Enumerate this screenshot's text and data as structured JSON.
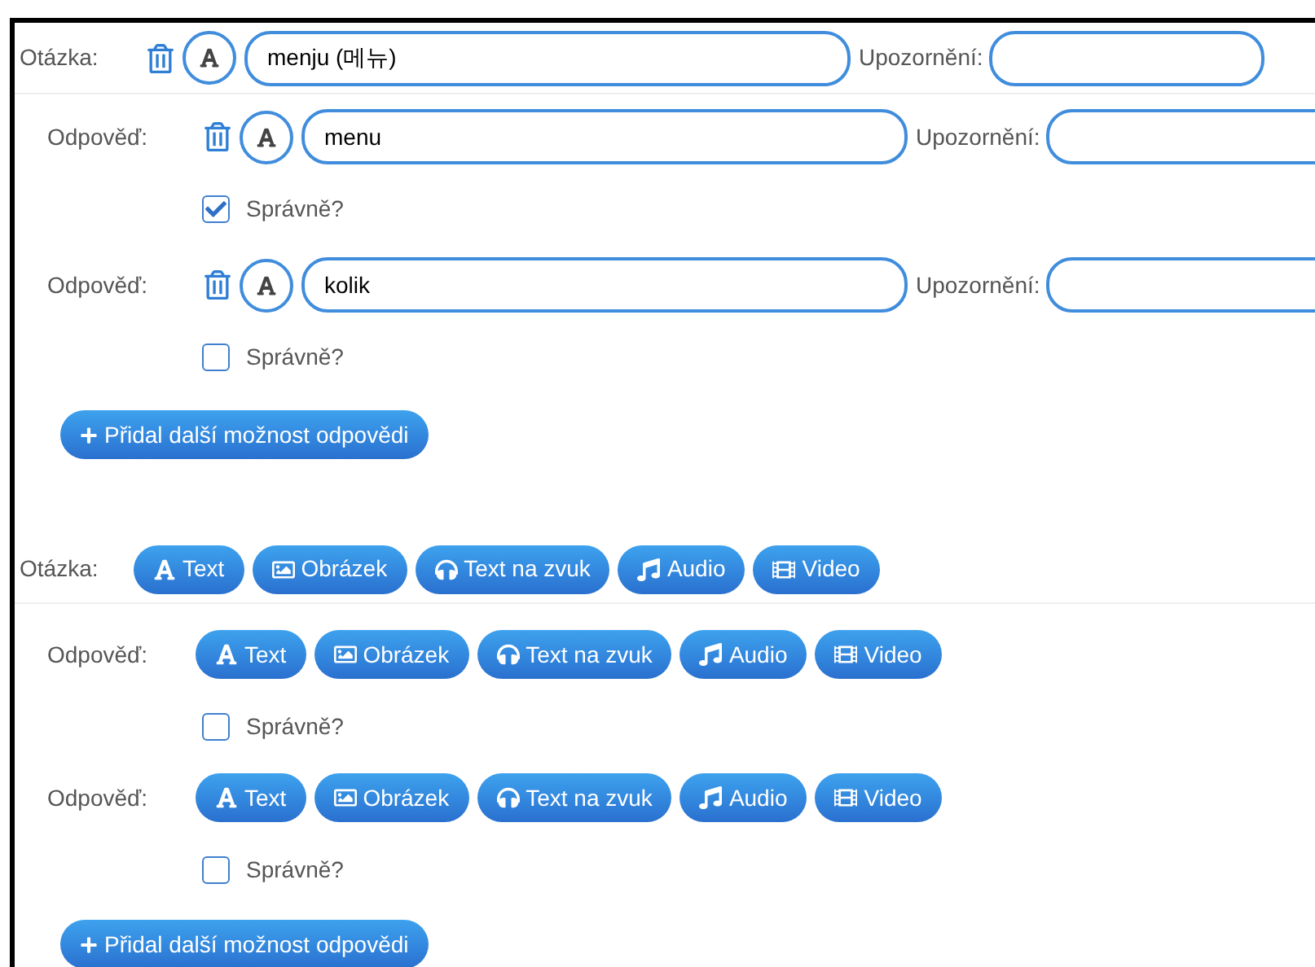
{
  "questions": [
    {
      "kind": "text",
      "label": "Otázka:",
      "value": "menju (메뉴)",
      "warning_label": "Upozornění:",
      "answers": [
        {
          "label": "Odpověď:",
          "value": "menu",
          "warning_label": "Upozornění:",
          "correct_label": "Správně?",
          "correct": true
        },
        {
          "label": "Odpověď:",
          "value": "kolik",
          "warning_label": "Upozornění:",
          "correct_label": "Správně?",
          "correct": false
        }
      ],
      "add_button": "Přidal další možnost odpovědi"
    },
    {
      "kind": "choose_type",
      "label": "Otázka:",
      "type_buttons": [
        {
          "kind": "text",
          "label": "Text"
        },
        {
          "kind": "image",
          "label": "Obrázek"
        },
        {
          "kind": "speech",
          "label": "Text na zvuk"
        },
        {
          "kind": "audio",
          "label": "Audio"
        },
        {
          "kind": "video",
          "label": "Video"
        }
      ],
      "answers": [
        {
          "label": "Odpověď:",
          "type_buttons": [
            {
              "kind": "text",
              "label": "Text"
            },
            {
              "kind": "image",
              "label": "Obrázek"
            },
            {
              "kind": "speech",
              "label": "Text na zvuk"
            },
            {
              "kind": "audio",
              "label": "Audio"
            },
            {
              "kind": "video",
              "label": "Video"
            }
          ],
          "correct_label": "Správně?",
          "correct": false
        },
        {
          "label": "Odpověď:",
          "type_buttons": [
            {
              "kind": "text",
              "label": "Text"
            },
            {
              "kind": "image",
              "label": "Obrázek"
            },
            {
              "kind": "speech",
              "label": "Text na zvuk"
            },
            {
              "kind": "audio",
              "label": "Audio"
            },
            {
              "kind": "video",
              "label": "Video"
            }
          ],
          "correct_label": "Správně?",
          "correct": false
        }
      ],
      "add_button": "Přidal další možnost odpovědi"
    }
  ]
}
